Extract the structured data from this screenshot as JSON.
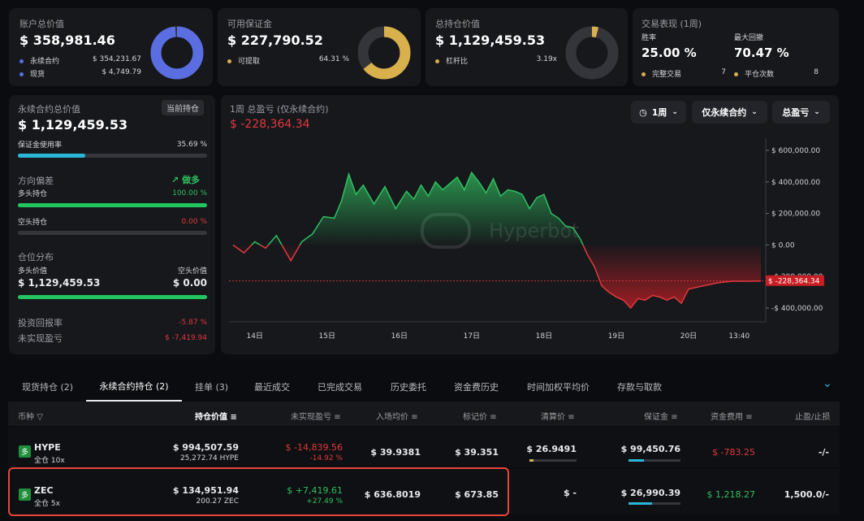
{
  "colors": {
    "accent_blue": "#5b6ee1",
    "accent_gold": "#d8b04c",
    "red": "#e0393e",
    "green": "#2fbf5f",
    "cyan": "#2bb6d8",
    "highlight": "#e8453c"
  },
  "summary": {
    "account": {
      "title": "账户总价值",
      "value": "$ 358,981.46",
      "perp_label": "永续合约",
      "perp_value": "$ 354,231.67",
      "spot_label": "现货",
      "spot_value": "$ 4,749.79",
      "donut_pct": 98.7
    },
    "margin": {
      "title": "可用保证金",
      "value": "$ 227,790.52",
      "withdraw_label": "可提取",
      "withdraw_value": "64.31 %",
      "donut_pct": 64.31
    },
    "position": {
      "title": "总持仓价值",
      "value": "$ 1,129,459.53",
      "leverage_label": "杠杆比",
      "leverage_value": "3.19x",
      "donut_pct": 4
    },
    "performance": {
      "title": "交易表现 (1周)",
      "winrate_label": "胜率",
      "winrate_value": "25.00 %",
      "drawdown_label": "最大回撤",
      "drawdown_value": "70.47 %",
      "trades_label": "完整交易",
      "trades_value": "7",
      "close_label": "平仓次数",
      "close_value": "8"
    }
  },
  "left_panel": {
    "title": "永续合约总价值",
    "badge": "当前持仓",
    "value": "$ 1,129,459.53",
    "margin_usage_label": "保证金使用率",
    "margin_usage_value": "35.69 %",
    "margin_usage_pct": 35.69,
    "bias_label": "方向偏差",
    "bias_value": "做多",
    "long_label": "多头持仓",
    "long_pct_text": "100.00 %",
    "long_pct": 100,
    "short_label": "空头持仓",
    "short_pct_text": "0.00 %",
    "short_pct": 0,
    "dist_label": "仓位分布",
    "long_value_label": "多头价值",
    "short_value_label": "空头价值",
    "long_value": "$ 1,129,459.53",
    "short_value": "$ 0.00",
    "dist_long_pct": 100,
    "roi_label": "投资回报率",
    "roi_value": "-5.87 %",
    "upnl_label": "未实现盈亏",
    "upnl_value": "$ -7,419.94"
  },
  "chart_panel": {
    "title": "1周 总盈亏 (仅永续合约)",
    "value": "$ -228,364.34",
    "btn_period": "1周",
    "btn_scope": "仅永续合约",
    "btn_metric": "总盈亏",
    "watermark": "Hyperbot",
    "current_tag": "$ -228,364.34"
  },
  "chart_data": {
    "type": "area",
    "ylim": [
      -450000,
      650000
    ],
    "yticks": [
      "$ 600,000.00",
      "$ 400,000.00",
      "$ 200,000.00",
      "$ 0.00",
      "-$ 200,000.00",
      "-$ 400,000.00"
    ],
    "ytick_values": [
      600000,
      400000,
      200000,
      0,
      -200000,
      -400000
    ],
    "xticks": [
      "14日",
      "15日",
      "16日",
      "17日",
      "18日",
      "19日",
      "20日",
      "13:40"
    ],
    "xtick_t": [
      0.3,
      1.3,
      2.3,
      3.3,
      4.3,
      5.3,
      6.3,
      7.0
    ],
    "t": [
      0,
      0.15,
      0.3,
      0.45,
      0.6,
      0.8,
      0.95,
      1.1,
      1.25,
      1.4,
      1.5,
      1.6,
      1.7,
      1.8,
      1.95,
      2.1,
      2.25,
      2.4,
      2.5,
      2.6,
      2.7,
      2.8,
      2.9,
      3.0,
      3.1,
      3.2,
      3.3,
      3.4,
      3.5,
      3.6,
      3.7,
      3.8,
      3.9,
      4.0,
      4.1,
      4.2,
      4.3,
      4.4,
      4.5,
      4.6,
      4.7,
      4.8,
      4.9,
      5.0,
      5.1,
      5.2,
      5.3,
      5.4,
      5.5,
      5.6,
      5.7,
      5.8,
      5.9,
      6.0,
      6.1,
      6.2,
      6.3,
      6.5,
      6.7,
      6.9,
      7.1,
      7.3
    ],
    "values": [
      0,
      -50000,
      20000,
      -20000,
      60000,
      -100000,
      20000,
      70000,
      180000,
      170000,
      280000,
      450000,
      320000,
      380000,
      260000,
      370000,
      230000,
      340000,
      290000,
      380000,
      310000,
      400000,
      350000,
      390000,
      430000,
      350000,
      460000,
      400000,
      330000,
      420000,
      310000,
      350000,
      340000,
      320000,
      230000,
      300000,
      320000,
      200000,
      170000,
      120000,
      110000,
      40000,
      -60000,
      -140000,
      -260000,
      -300000,
      -330000,
      -350000,
      -400000,
      -340000,
      -350000,
      -320000,
      -330000,
      -350000,
      -330000,
      -370000,
      -280000,
      -260000,
      -240000,
      -230000,
      -230000,
      -228364
    ]
  },
  "tabs": [
    "现货持仓 (2)",
    "永续合约持仓 (2)",
    "挂单 (3)",
    "最近成交",
    "已完成交易",
    "历史委托",
    "资金费历史",
    "时间加权平均价",
    "存款与取款"
  ],
  "table": {
    "headers": {
      "coin": "币种",
      "value": "持仓价值",
      "upnl": "未实现盈亏",
      "entry": "入场均价",
      "mark": "标记价",
      "liq": "清算价",
      "margin": "保证金",
      "funding": "资金费用",
      "tpsl": "止盈/止损"
    },
    "rows": [
      {
        "side": "多",
        "coin": "HYPE",
        "mode": "全仓 10x",
        "value": "$ 994,507.59",
        "qty": "25,272.74 HYPE",
        "upnl": "$ -14,839.56",
        "upnl_pct": "-14.92 %",
        "entry": "$ 39.9381",
        "mark": "$ 39.351",
        "liq": "$ 26.9491",
        "margin": "$ 99,450.76",
        "margin_pct": 30,
        "funding": "$ -783.25",
        "tpsl": "-/-"
      },
      {
        "side": "多",
        "coin": "ZEC",
        "mode": "全仓 5x",
        "value": "$ 134,951.94",
        "qty": "200.27 ZEC",
        "upnl": "$ +7,419.61",
        "upnl_pct": "+27.49 %",
        "entry": "$ 636.8019",
        "mark": "$ 673.85",
        "liq": "$ -",
        "margin": "$ 26,990.39",
        "margin_pct": 45,
        "funding": "$ 1,218.27",
        "tpsl": "1,500.0/-"
      }
    ]
  }
}
